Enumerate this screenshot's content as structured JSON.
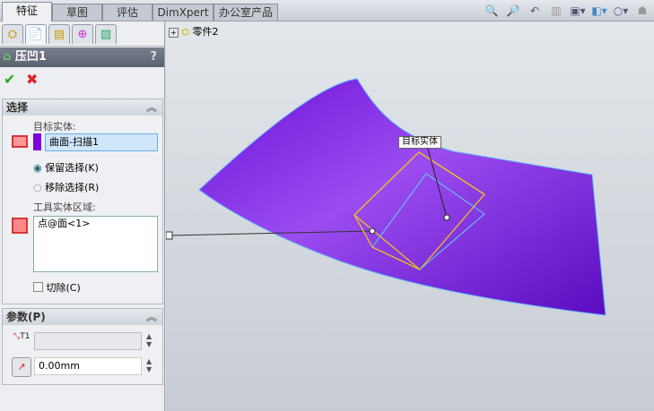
{
  "tabs": [
    "特征",
    "草图",
    "评估",
    "DimXpert",
    "办公室产品"
  ],
  "toolbar_icons": [
    "zoom-to-fit-icon",
    "zoom-area-icon",
    "previous-view-icon",
    "section-view-icon",
    "view-orientation-icon",
    "display-style-icon",
    "hide-show-icon",
    "appearance-icon"
  ],
  "tree": {
    "expand": "+",
    "part": "零件2"
  },
  "feature": {
    "title": "压凹1",
    "help": "?",
    "ok": "✔",
    "cancel": "✖"
  },
  "selection": {
    "header": "选择",
    "target_label": "目标实体:",
    "target_value": "曲面-扫描1",
    "target_color": "#7b00e0",
    "keep": "保留选择(K)",
    "remove": "移除选择(R)",
    "tool_label": "工具实体区域:",
    "tool_value": "点@面<1>",
    "cut": "切除(C)",
    "keep_checked": true,
    "cut_checked": false
  },
  "params": {
    "header": "参数(P)",
    "thickness_value": "",
    "clearance_value": "0.00mm",
    "thickness_icon_text": "T1"
  },
  "viewport": {
    "callout": "目标实体",
    "surface_color": "#7a1fe0"
  }
}
